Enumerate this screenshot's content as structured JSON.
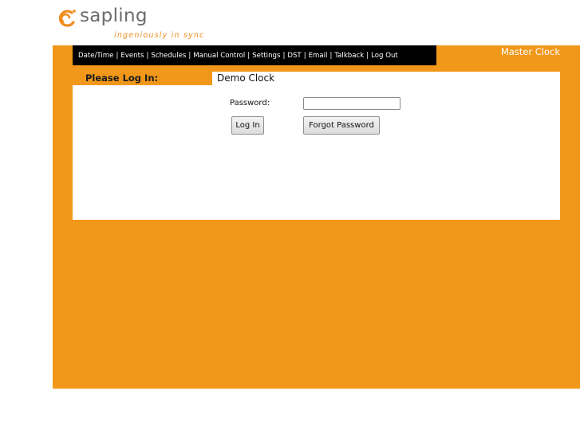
{
  "logo": {
    "word": "sapling",
    "tagline": "ingeniously in sync",
    "brand_color": "#f08c1e"
  },
  "nav": {
    "items": [
      "Date/Time",
      "Events",
      "Schedules",
      "Manual Control",
      "Settings",
      "DST",
      "Email",
      "Talkback",
      "Log Out"
    ],
    "separator": "|"
  },
  "header": {
    "master_label": "Master Clock"
  },
  "login": {
    "heading": "Please Log In:",
    "clock_name": "Demo Clock",
    "password_label": "Password:",
    "password_value": "",
    "login_button": "Log In",
    "forgot_button": "Forgot Password"
  },
  "colors": {
    "accent": "#f1981a",
    "nav_bg": "#000000",
    "panel_bg": "#ffffff"
  }
}
